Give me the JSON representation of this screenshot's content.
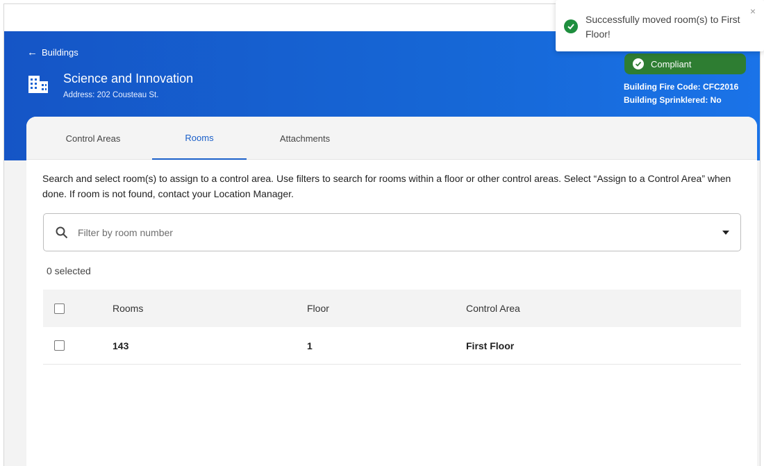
{
  "header": {
    "back_label": "Buildings",
    "building_name": "Science and Innovation",
    "address": "Address: 202 Cousteau St.",
    "compliance_badge": "Compliant",
    "fire_code": "Building Fire Code:  CFC2016",
    "sprinklered": "Building Sprinklered:  No"
  },
  "tabs": [
    {
      "label": "Control Areas",
      "active": false
    },
    {
      "label": "Rooms",
      "active": true
    },
    {
      "label": "Attachments",
      "active": false
    }
  ],
  "main": {
    "instructions": "Search and select room(s) to assign to a control area. Use filters to search for rooms within a floor or other control areas. Select “Assign to a Control Area” when done. If room is not found, contact your Location Manager.",
    "search_placeholder": "Filter by room number",
    "selected_count": "0 selected"
  },
  "table": {
    "columns": [
      "Rooms",
      "Floor",
      "Control Area"
    ],
    "rows": [
      {
        "room": "143",
        "floor": "1",
        "control_area": "First Floor"
      }
    ]
  },
  "toast": {
    "message": "Successfully moved room(s) to First Floor!",
    "close_glyph": "×"
  },
  "colors": {
    "hero_blue": "#1667d6",
    "accent_blue": "#1a5fc9",
    "compliant_green": "#2e7d32",
    "toast_success_green": "#1e8e3e"
  },
  "icons": [
    "back-arrow-icon",
    "building-icon",
    "check-circle-icon",
    "search-icon",
    "chevron-down-icon",
    "close-icon"
  ]
}
